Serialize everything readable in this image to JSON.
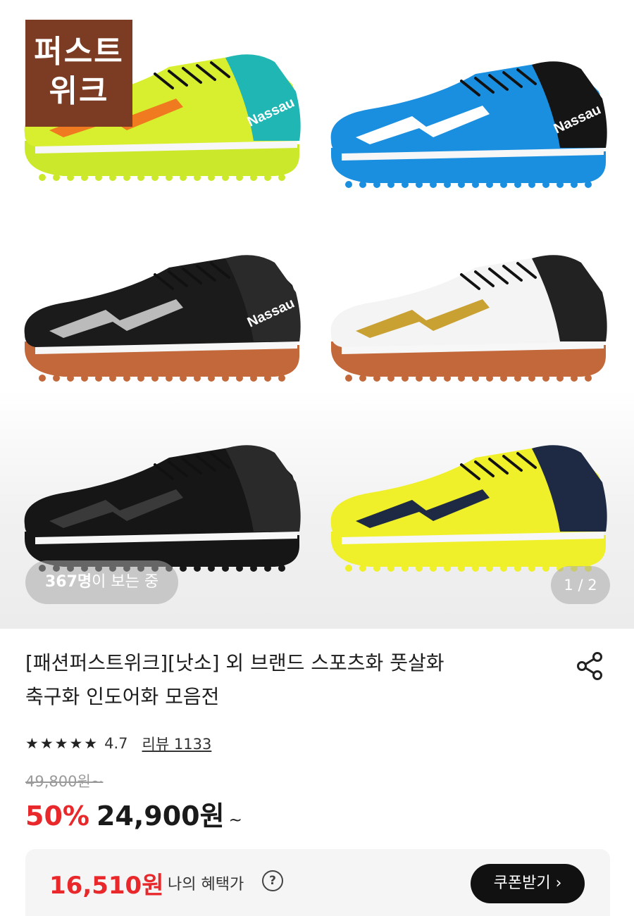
{
  "gallery": {
    "badge_line1": "퍼스트",
    "badge_line2": "위크",
    "viewers_count": "367명",
    "viewers_text": "이 보는 중",
    "pager": "1 / 2",
    "shoes": [
      {
        "name": "shoe-neon-teal",
        "brand": "Nassau",
        "colors": {
          "upper": "#d7ef2e",
          "collar": "#1fb6b3",
          "stripe": "#f07a1f",
          "sole": "#cce82a"
        }
      },
      {
        "name": "shoe-blue-black",
        "brand": "Nassau",
        "colors": {
          "upper": "#1a8fe0",
          "collar": "#151515",
          "stripe": "#ffffff",
          "sole": "#1a8fe0"
        }
      },
      {
        "name": "shoe-black-indoor",
        "brand": "Nassau",
        "colors": {
          "upper": "#1b1b1b",
          "collar": "#2a2a2a",
          "stripe": "#bbbbbb",
          "sole": "#c2683a"
        }
      },
      {
        "name": "shoe-white-indoor",
        "brand": "",
        "colors": {
          "upper": "#f4f4f4",
          "collar": "#222222",
          "stripe": "#c9a133",
          "sole": "#c2683a"
        }
      },
      {
        "name": "shoe-all-black",
        "brand": "",
        "colors": {
          "upper": "#161616",
          "collar": "#2a2a2a",
          "stripe": "#3a3a3a",
          "sole": "#161616"
        }
      },
      {
        "name": "shoe-yellow-navy",
        "brand": "",
        "colors": {
          "upper": "#eff02a",
          "collar": "#1e2a44",
          "stripe": "#1e2a44",
          "sole": "#eff02a"
        }
      }
    ]
  },
  "product": {
    "title_line1": "[패션퍼스트위크][낫소] 외 브랜드 스포츠화 풋살화",
    "title_line2": "축구화 인도어화 모음전",
    "stars": "★★★★★",
    "rating": "4.7",
    "reviews": "리뷰 1133",
    "original_price": "49,800원~",
    "discount": "50%",
    "price": "24,900원",
    "price_suffix": "~"
  },
  "benefit": {
    "price": "16,510원",
    "label": "나의 혜택가",
    "help_icon": "?",
    "coupon_button": "쿠폰받기 ›"
  },
  "colors": {
    "accent_red": "#e8282b",
    "badge_brown": "#7b3c23"
  }
}
